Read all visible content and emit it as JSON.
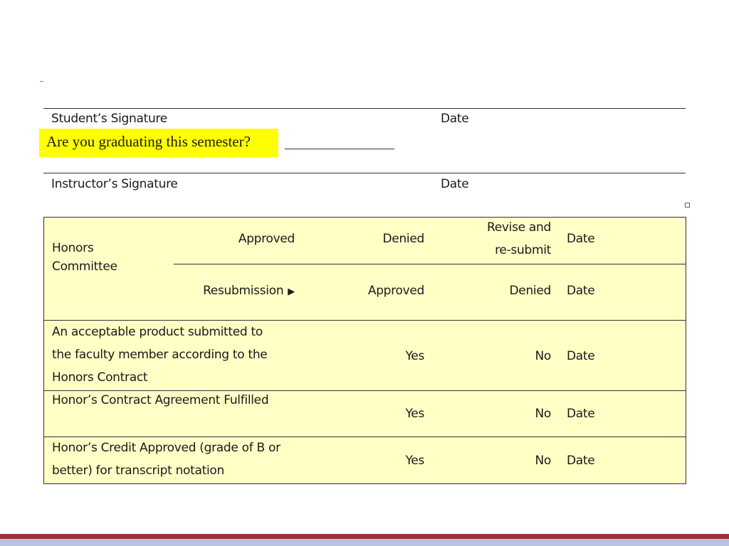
{
  "signatures": {
    "student_label": "Student’s Signature",
    "student_date": "Date",
    "instructor_label": "Instructor’s Signature",
    "instructor_date": "Date"
  },
  "question": {
    "text": "Are you graduating this semester?",
    "highlight_color": "#ffff00"
  },
  "committee": {
    "label": "Honors Committee",
    "row1": {
      "approved": "Approved",
      "denied": "Denied",
      "revise_line1": "Revise and",
      "revise_line2": "re-submit",
      "date": "Date"
    },
    "row2": {
      "resubmission": "Resubmission",
      "arrow_icon": "triangle-right-icon",
      "approved": "Approved",
      "denied": "Denied",
      "date": "Date"
    }
  },
  "checks": [
    {
      "lines": [
        "An acceptable product submitted to",
        "the faculty member according to the",
        "Honors Contract"
      ],
      "yes": "Yes",
      "no": "No",
      "date": "Date"
    },
    {
      "lines": [
        "Honor’s Contract Agreement Fulfilled"
      ],
      "yes": "Yes",
      "no": "No",
      "date": "Date"
    },
    {
      "lines": [
        "Honor’s Credit Approved (grade of B or",
        "better) for transcript notation"
      ],
      "yes": "Yes",
      "no": "No",
      "date": "Date"
    }
  ],
  "colors": {
    "table_fill": "#ffffc6",
    "footer_red": "#9b3336",
    "footer_blue": "#b7c6dc"
  }
}
